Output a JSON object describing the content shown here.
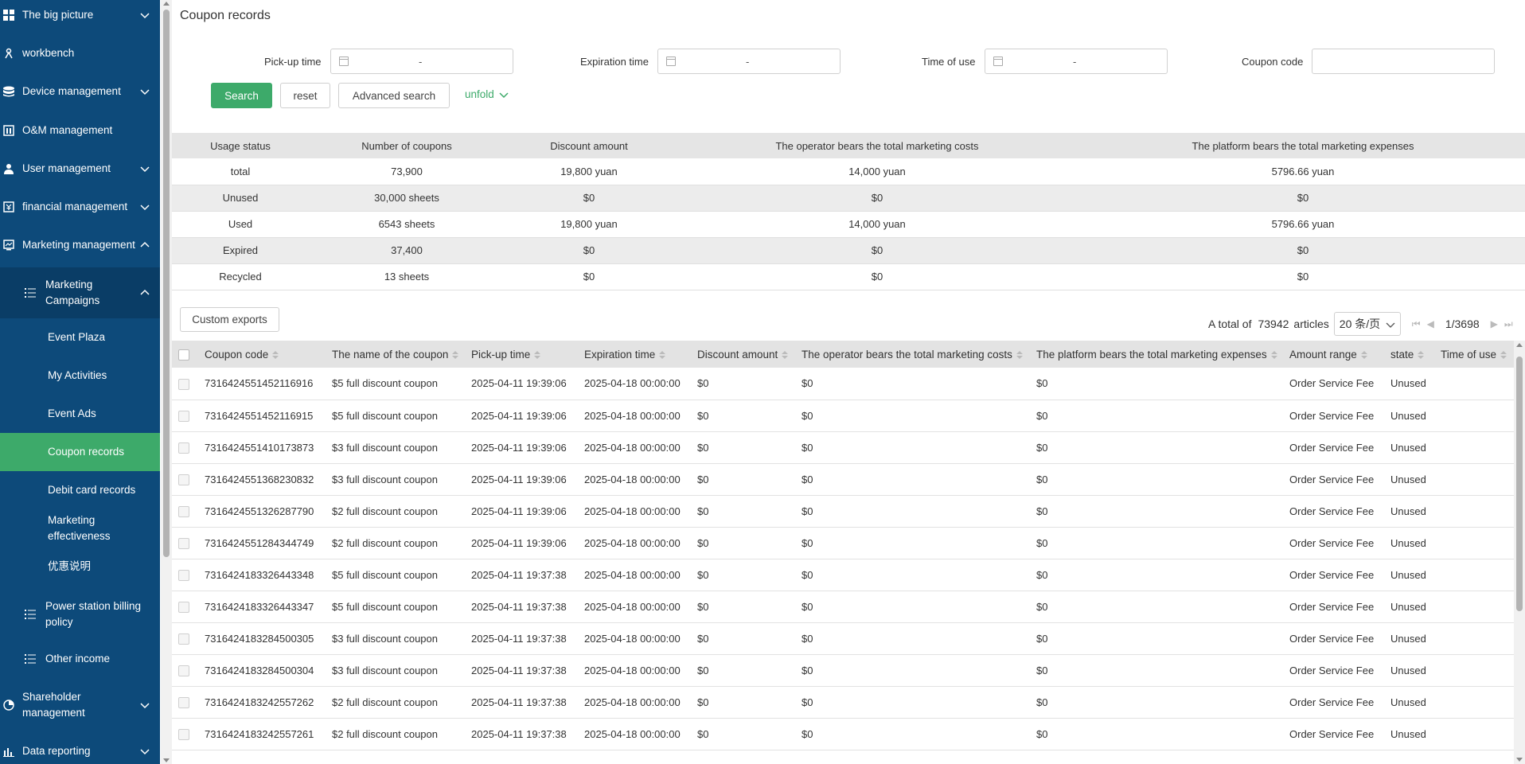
{
  "sidebar": {
    "items": [
      {
        "label": "The big picture",
        "icon": "grid-icon"
      },
      {
        "label": "workbench",
        "icon": "workbench-icon"
      },
      {
        "label": "Device management",
        "icon": "database-icon"
      },
      {
        "label": "O&M management",
        "icon": "maintenance-icon"
      },
      {
        "label": "User management",
        "icon": "user-icon"
      },
      {
        "label": "financial management",
        "icon": "finance-icon"
      },
      {
        "label": "Marketing management",
        "icon": "chart-icon"
      },
      {
        "label": "Marketing Campaigns",
        "icon": "list-icon"
      },
      {
        "label": "Event Plaza"
      },
      {
        "label": "My Activities"
      },
      {
        "label": "Event Ads"
      },
      {
        "label": "Coupon records"
      },
      {
        "label": "Debit card records"
      },
      {
        "label": "Marketing effectiveness"
      },
      {
        "label": "优惠说明"
      },
      {
        "label": "Power station billing policy",
        "icon": "list-icon"
      },
      {
        "label": "Other income",
        "icon": "list-icon"
      },
      {
        "label": "Shareholder management",
        "icon": "pie-icon"
      },
      {
        "label": "Data reporting",
        "icon": "bar-chart-icon"
      }
    ],
    "accent_color": "#3daa6a",
    "bg_color": "#0d4a7a"
  },
  "page": {
    "title": "Coupon records"
  },
  "filters": {
    "pickup_label": "Pick-up time",
    "expiration_label": "Expiration time",
    "time_of_use_label": "Time of use",
    "coupon_code_label": "Coupon code",
    "range_separator": "-",
    "coupon_code_value": ""
  },
  "buttons": {
    "search": "Search",
    "reset": "reset",
    "advanced": "Advanced search",
    "unfold": "unfold",
    "custom_exports": "Custom exports"
  },
  "summary": {
    "headers": [
      "Usage status",
      "Number of coupons",
      "Discount amount",
      "The operator bears the total marketing costs",
      "The platform bears the total marketing expenses"
    ],
    "rows": [
      [
        "total",
        "73,900",
        "19,800 yuan",
        "14,000 yuan",
        "5796.66 yuan"
      ],
      [
        "Unused",
        "30,000 sheets",
        "$0",
        "$0",
        "$0"
      ],
      [
        "Used",
        "6543 sheets",
        "19,800 yuan",
        "14,000 yuan",
        "5796.66 yuan"
      ],
      [
        "Expired",
        "37,400",
        "$0",
        "$0",
        "$0"
      ],
      [
        "Recycled",
        "13 sheets",
        "$0",
        "$0",
        "$0"
      ]
    ]
  },
  "pagination": {
    "total_prefix": "A total of",
    "total": "73942",
    "total_suffix": "articles",
    "page_size": "20 条/页",
    "page_info": "1/3698"
  },
  "table": {
    "headers": [
      "Coupon code",
      "The name of the coupon",
      "Pick-up time",
      "Expiration time",
      "Discount amount",
      "The operator bears the total marketing costs",
      "The platform bears the total marketing expenses",
      "Amount range",
      "state",
      "Time of use"
    ],
    "rows": [
      [
        "7316424551452116916",
        "$5 full discount coupon",
        "2025-04-11 19:39:06",
        "2025-04-18 00:00:00",
        "$0",
        "$0",
        "$0",
        "Order Service Fee",
        "Unused",
        ""
      ],
      [
        "7316424551452116915",
        "$5 full discount coupon",
        "2025-04-11 19:39:06",
        "2025-04-18 00:00:00",
        "$0",
        "$0",
        "$0",
        "Order Service Fee",
        "Unused",
        ""
      ],
      [
        "7316424551410173873",
        "$3 full discount coupon",
        "2025-04-11 19:39:06",
        "2025-04-18 00:00:00",
        "$0",
        "$0",
        "$0",
        "Order Service Fee",
        "Unused",
        ""
      ],
      [
        "7316424551368230832",
        "$3 full discount coupon",
        "2025-04-11 19:39:06",
        "2025-04-18 00:00:00",
        "$0",
        "$0",
        "$0",
        "Order Service Fee",
        "Unused",
        ""
      ],
      [
        "7316424551326287790",
        "$2 full discount coupon",
        "2025-04-11 19:39:06",
        "2025-04-18 00:00:00",
        "$0",
        "$0",
        "$0",
        "Order Service Fee",
        "Unused",
        ""
      ],
      [
        "7316424551284344749",
        "$2 full discount coupon",
        "2025-04-11 19:39:06",
        "2025-04-18 00:00:00",
        "$0",
        "$0",
        "$0",
        "Order Service Fee",
        "Unused",
        ""
      ],
      [
        "7316424183326443348",
        "$5 full discount coupon",
        "2025-04-11 19:37:38",
        "2025-04-18 00:00:00",
        "$0",
        "$0",
        "$0",
        "Order Service Fee",
        "Unused",
        ""
      ],
      [
        "7316424183326443347",
        "$5 full discount coupon",
        "2025-04-11 19:37:38",
        "2025-04-18 00:00:00",
        "$0",
        "$0",
        "$0",
        "Order Service Fee",
        "Unused",
        ""
      ],
      [
        "7316424183284500305",
        "$3 full discount coupon",
        "2025-04-11 19:37:38",
        "2025-04-18 00:00:00",
        "$0",
        "$0",
        "$0",
        "Order Service Fee",
        "Unused",
        ""
      ],
      [
        "7316424183284500304",
        "$3 full discount coupon",
        "2025-04-11 19:37:38",
        "2025-04-18 00:00:00",
        "$0",
        "$0",
        "$0",
        "Order Service Fee",
        "Unused",
        ""
      ],
      [
        "7316424183242557262",
        "$2 full discount coupon",
        "2025-04-11 19:37:38",
        "2025-04-18 00:00:00",
        "$0",
        "$0",
        "$0",
        "Order Service Fee",
        "Unused",
        ""
      ],
      [
        "7316424183242557261",
        "$2 full discount coupon",
        "2025-04-11 19:37:38",
        "2025-04-18 00:00:00",
        "$0",
        "$0",
        "$0",
        "Order Service Fee",
        "Unused",
        ""
      ]
    ]
  }
}
